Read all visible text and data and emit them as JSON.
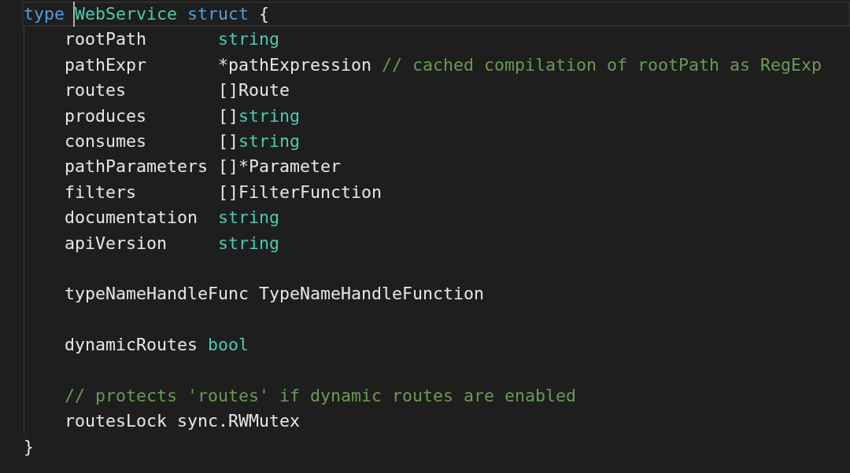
{
  "editor": {
    "lines": [
      {
        "current": true,
        "aligned": false,
        "groups": [
          [
            {
              "text": "type",
              "kind": "keyword",
              "cursor": false
            }
          ],
          [
            {
              "text": "WebService",
              "kind": "type",
              "cursor": true
            }
          ],
          [
            {
              "text": "struct",
              "kind": "keyword",
              "cursor": false
            }
          ],
          [
            {
              "text": "{",
              "kind": "plain",
              "cursor": false
            }
          ]
        ],
        "children": [
          {
            "current": false,
            "aligned": true,
            "groups": [
              [
                {
                  "text": "rootPath",
                  "kind": "plain",
                  "cursor": false
                }
              ],
              [
                {
                  "text": "string",
                  "kind": "type",
                  "cursor": false
                }
              ]
            ]
          },
          {
            "current": false,
            "aligned": true,
            "groups": [
              [
                {
                  "text": "pathExpr",
                  "kind": "plain",
                  "cursor": false
                }
              ],
              [
                {
                  "text": "*pathExpression",
                  "kind": "plain",
                  "cursor": false
                }
              ],
              [
                {
                  "text": "// cached compilation of rootPath as RegExp",
                  "kind": "comment",
                  "cursor": false
                }
              ]
            ]
          },
          {
            "current": false,
            "aligned": true,
            "groups": [
              [
                {
                  "text": "routes",
                  "kind": "plain",
                  "cursor": false
                }
              ],
              [
                {
                  "text": "[]Route",
                  "kind": "plain",
                  "cursor": false
                }
              ]
            ]
          },
          {
            "current": false,
            "aligned": true,
            "groups": [
              [
                {
                  "text": "produces",
                  "kind": "plain",
                  "cursor": false
                }
              ],
              [
                {
                  "text": "[]",
                  "kind": "plain",
                  "cursor": false
                },
                {
                  "text": "string",
                  "kind": "type",
                  "cursor": false
                }
              ]
            ]
          },
          {
            "current": false,
            "aligned": true,
            "groups": [
              [
                {
                  "text": "consumes",
                  "kind": "plain",
                  "cursor": false
                }
              ],
              [
                {
                  "text": "[]",
                  "kind": "plain",
                  "cursor": false
                },
                {
                  "text": "string",
                  "kind": "type",
                  "cursor": false
                }
              ]
            ]
          },
          {
            "current": false,
            "groups": [
              [
                {
                  "text": "pathParameters",
                  "kind": "plain",
                  "cursor": false
                }
              ],
              [
                {
                  "text": "[]*Parameter",
                  "kind": "plain",
                  "cursor": false
                }
              ]
            ]
          },
          {
            "current": false,
            "aligned": true,
            "groups": [
              [
                {
                  "text": "filters",
                  "kind": "plain",
                  "cursor": false
                }
              ],
              [
                {
                  "text": "[]FilterFunction",
                  "kind": "plain",
                  "cursor": false
                }
              ]
            ]
          },
          {
            "current": false,
            "aligned": true,
            "groups": [
              [
                {
                  "text": "documentation",
                  "kind": "plain",
                  "cursor": false
                }
              ],
              [
                {
                  "text": "string",
                  "kind": "type",
                  "cursor": false
                }
              ]
            ]
          },
          {
            "current": false,
            "aligned": true,
            "groups": [
              [
                {
                  "text": "apiVersion",
                  "kind": "plain",
                  "cursor": false
                }
              ],
              [
                {
                  "text": "string",
                  "kind": "type",
                  "cursor": false
                }
              ]
            ]
          },
          {
            "current": false
          },
          {
            "current": false,
            "groups": [
              [
                {
                  "text": "typeNameHandleFunc",
                  "kind": "plain",
                  "cursor": false
                }
              ],
              [
                {
                  "text": "TypeNameHandleFunction",
                  "kind": "plain",
                  "cursor": false
                }
              ]
            ]
          },
          {
            "current": false
          },
          {
            "current": false,
            "aligned": false,
            "groups": [
              [
                {
                  "text": "dynamicRoutes",
                  "kind": "plain",
                  "cursor": false
                }
              ],
              [
                {
                  "text": "bool",
                  "kind": "type",
                  "cursor": false
                }
              ]
            ]
          },
          {
            "current": false
          },
          {
            "current": false,
            "groups": [
              [
                {
                  "text": "// protects 'routes' if dynamic routes are enabled",
                  "kind": "comment",
                  "cursor": false
                }
              ]
            ]
          },
          {
            "current": false,
            "aligned": false,
            "groups": [
              [
                {
                  "text": "routesLock",
                  "kind": "plain",
                  "cursor": false
                }
              ],
              [
                {
                  "text": "sync.RWMutex",
                  "kind": "plain",
                  "cursor": false
                }
              ]
            ]
          }
        ]
      },
      {
        "current": false,
        "groups": [
          [
            {
              "text": "}",
              "kind": "plain",
              "cursor": false
            }
          ]
        ]
      }
    ]
  }
}
